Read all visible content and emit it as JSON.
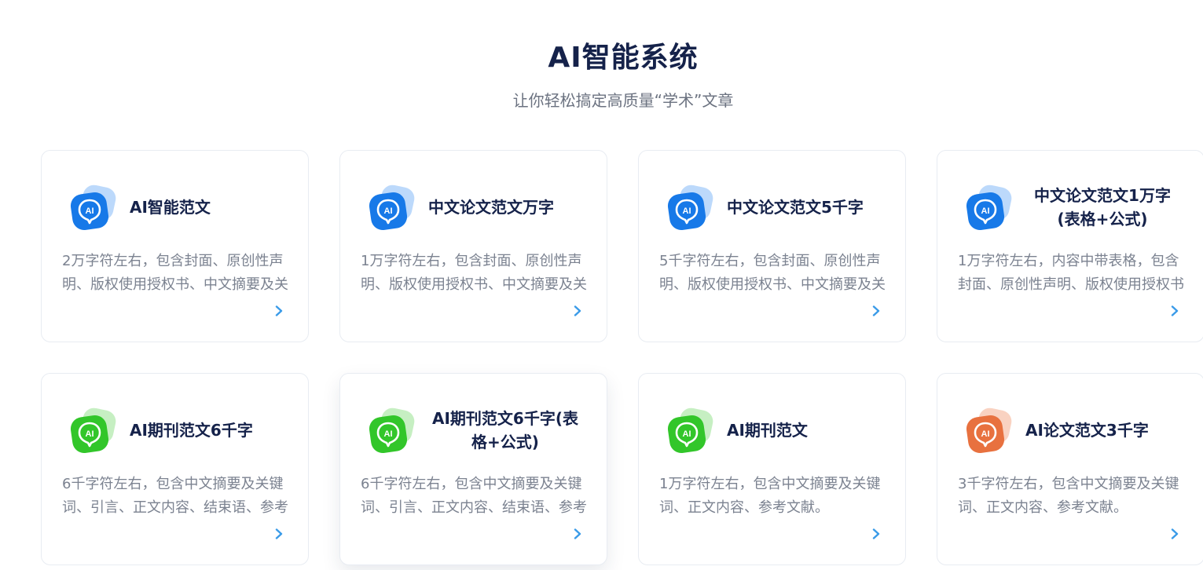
{
  "header": {
    "title": "AI智能系统",
    "subtitle": "让你轻松搞定高质量“学术”文章"
  },
  "colors": {
    "blue": "#1779e8",
    "blue_light": "#bcd9fb",
    "green": "#32c62a",
    "green_light": "#c6efc2",
    "orange": "#e8713f",
    "orange_light": "#f9d2c1",
    "arrow": "#3a9be8"
  },
  "cards": [
    {
      "title": "AI智能范文",
      "desc": "2万字符左右，包含封面、原创性声明、版权使用授权书、中文摘要及关键词",
      "icon": "ai-badge-blue-icon",
      "color": "blue"
    },
    {
      "title": "中文论文范文万字",
      "desc": "1万字符左右，包含封面、原创性声明、版权使用授权书、中文摘要及关键词",
      "icon": "ai-badge-blue-icon",
      "color": "blue"
    },
    {
      "title": "中文论文范文5千字",
      "desc": "5千字符左右，包含封面、原创性声明、版权使用授权书、中文摘要及关键词",
      "icon": "ai-badge-blue-icon",
      "color": "blue"
    },
    {
      "title": "中文论文范文1万字(表格+公式)",
      "desc": "1万字符左右，内容中带表格，包含封面、原创性声明、版权使用授权书",
      "icon": "ai-badge-blue-icon",
      "color": "blue"
    },
    {
      "title": "AI期刊范文6千字",
      "desc": "6千字符左右，包含中文摘要及关键词、引言、正文内容、结束语、参考文献",
      "icon": "ai-badge-green-icon",
      "color": "green"
    },
    {
      "title": "AI期刊范文6千字(表格+公式)",
      "desc": "6千字符左右，包含中文摘要及关键词、引言、正文内容、结束语、参考文献",
      "icon": "ai-badge-green-icon",
      "color": "green"
    },
    {
      "title": "AI期刊范文",
      "desc": "1万字符左右，包含中文摘要及关键词、正文内容、参考文献。",
      "icon": "ai-badge-green-icon",
      "color": "green"
    },
    {
      "title": "AI论文范文3千字",
      "desc": "3千字符左右，包含中文摘要及关键词、正文内容、参考文献。",
      "icon": "ai-badge-orange-icon",
      "color": "orange"
    }
  ]
}
